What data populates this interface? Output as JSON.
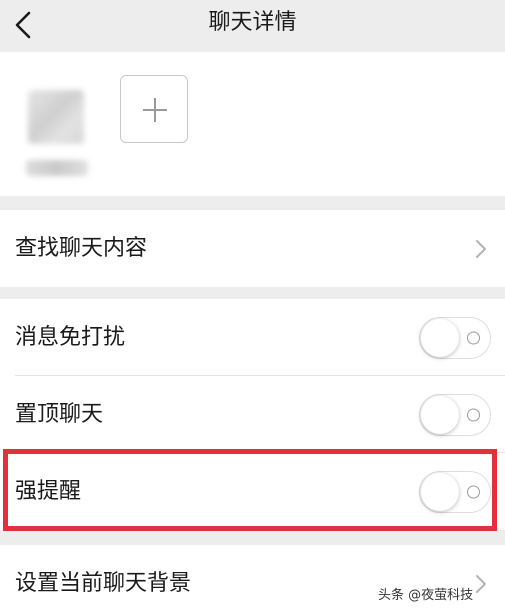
{
  "nav": {
    "title": "聊天详情",
    "back_icon": "chevron-left-icon"
  },
  "members": {
    "add_icon": "plus-icon"
  },
  "search_section": {
    "label": "查找聊天内容"
  },
  "settings": {
    "items": [
      {
        "label": "消息免打扰",
        "toggle_on": false
      },
      {
        "label": "置顶聊天",
        "toggle_on": false
      },
      {
        "label": "强提醒",
        "toggle_on": false
      }
    ]
  },
  "background_section": {
    "label": "设置当前聊天背景"
  },
  "watermark": "头条 @夜萤科技",
  "colors": {
    "page_bg": "#ededed",
    "card_bg": "#ffffff",
    "highlight": "#e0313d"
  }
}
